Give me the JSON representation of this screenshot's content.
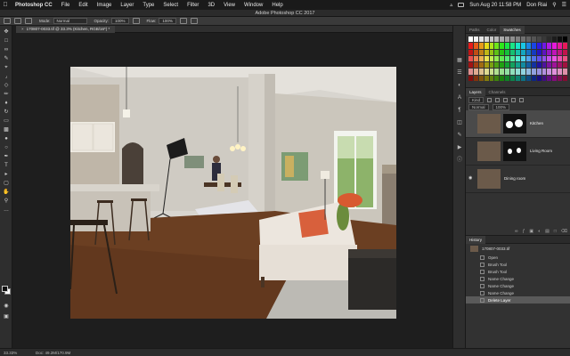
{
  "menubar": {
    "apple": "",
    "items": [
      "Photoshop CC",
      "File",
      "Edit",
      "Image",
      "Layer",
      "Type",
      "Select",
      "Filter",
      "3D",
      "View",
      "Window",
      "Help"
    ],
    "clock": "Sun Aug 20  11:58 PM",
    "user": "Don Riai"
  },
  "window": {
    "title": "Adobe Photoshop CC 2017"
  },
  "options": {
    "mode_label": "Mode:",
    "mode_value": "Normal",
    "opacity_label": "Opacity:",
    "opacity_value": "100%",
    "flow_label": "Flow:",
    "flow_value": "100%"
  },
  "document": {
    "tab_close": "×",
    "tab_title": "170807-0033.tif @ 33.3% (Kitchen, RGB/16*) *"
  },
  "status": {
    "zoom": "33.33%",
    "docsize": "Doc: 49.2M/170.9M"
  },
  "panels": {
    "top_tabs": [
      "Paths",
      "Color",
      "Swatches"
    ],
    "layer_tabs": [
      "Layers",
      "Channels"
    ],
    "layer_filter": "Kind",
    "layers": [
      {
        "name": "Kitchen",
        "selected": true
      },
      {
        "name": "Living Room",
        "selected": false
      },
      {
        "name": "Dining room",
        "selected": false
      }
    ],
    "history_title": "History",
    "history_snapshot": "170807-0033.tif",
    "history_items": [
      {
        "label": "Open",
        "selected": false
      },
      {
        "label": "Brush Tool",
        "selected": false
      },
      {
        "label": "Brush Tool",
        "selected": false
      },
      {
        "label": "Name Change",
        "selected": false
      },
      {
        "label": "Name Change",
        "selected": false
      },
      {
        "label": "Name Change",
        "selected": false
      },
      {
        "label": "Delete Layer",
        "selected": true
      }
    ]
  },
  "colors": {
    "accent": "#3a3a3a",
    "panel_bg": "#323232",
    "canvas_bg": "#1e1e1e"
  }
}
